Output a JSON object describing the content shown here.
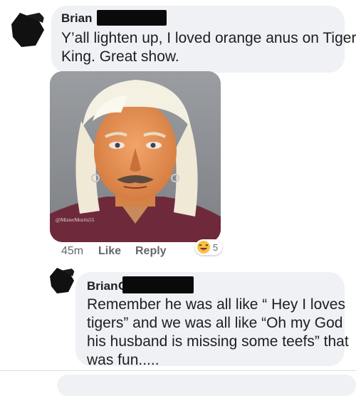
{
  "comments": [
    {
      "author": "Brian",
      "lines": [
        "Y’all lighten up, I loved orange anus on Tiger",
        "King. Great show."
      ],
      "image_watermark": "@MisterMorris55",
      "time": "45m",
      "like_label": "Like",
      "reply_label": "Reply",
      "reaction_icon": "laughing-emoji-icon",
      "reaction_count": "5"
    },
    {
      "author": "Brian",
      "author_suffix": "C",
      "lines": [
        "Remember he was all like “ Hey I loves",
        "tigers” and we was all like “Oh my God",
        "his husband is missing some teefs” that",
        "was fun....."
      ]
    }
  ],
  "colors": {
    "bubble": "#eff1f4",
    "text": "#1c1e21",
    "meta": "#65676b",
    "redaction": "#0a0a0a"
  }
}
